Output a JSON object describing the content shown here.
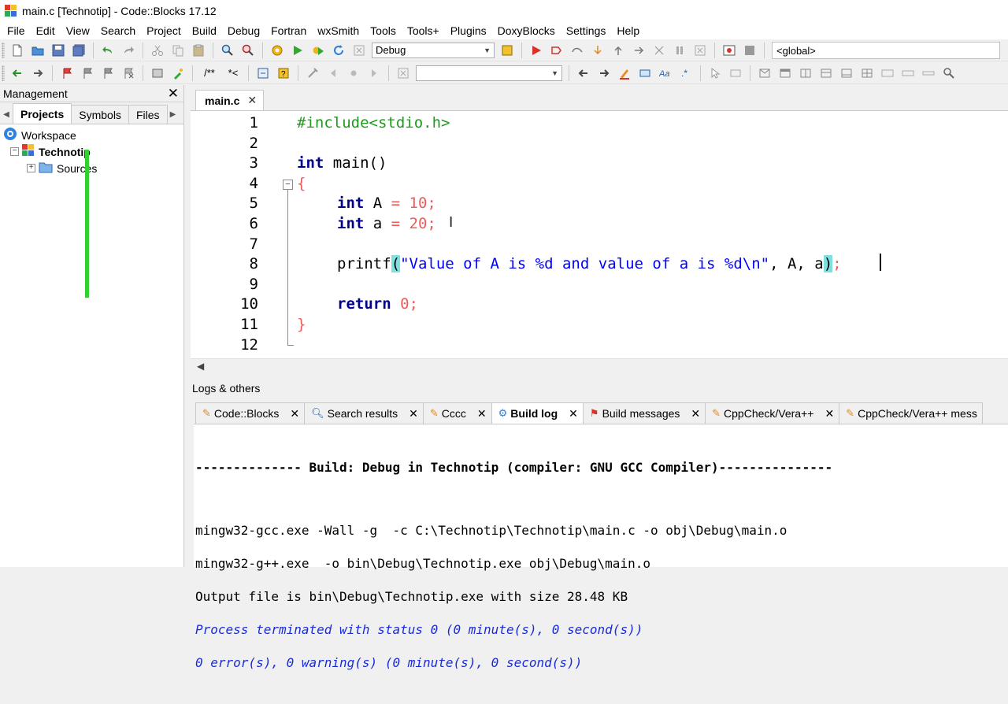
{
  "window": {
    "title": "main.c [Technotip] - Code::Blocks 17.12"
  },
  "menu": [
    "File",
    "Edit",
    "View",
    "Search",
    "Project",
    "Build",
    "Debug",
    "Fortran",
    "wxSmith",
    "Tools",
    "Tools+",
    "Plugins",
    "DoxyBlocks",
    "Settings",
    "Help"
  ],
  "toolbar": {
    "build_target": "Debug",
    "scope_value": "<global>",
    "search_value": "",
    "comment_block_label": "/**",
    "comment_line_label": "*<"
  },
  "management": {
    "title": "Management",
    "tabs": [
      "Projects",
      "Symbols",
      "Files"
    ],
    "tree": {
      "workspace": "Workspace",
      "project": "Technotip",
      "folder": "Sources"
    }
  },
  "editor": {
    "tab_label": "main.c",
    "line_numbers": [
      "1",
      "2",
      "3",
      "4",
      "5",
      "6",
      "7",
      "8",
      "9",
      "10",
      "11",
      "12"
    ],
    "code": {
      "l1": "#include<stdio.h>",
      "l3_kw": "int",
      "l3_rest": " main()",
      "l4": "{",
      "l5_kw": "int",
      "l5_var": " A ",
      "l5_op": "=",
      "l5_num": " 10;",
      "l6_kw": "int",
      "l6_var": " a ",
      "l6_op": "=",
      "l6_num": " 20;",
      "l8_fn": "printf",
      "l8_open": "(",
      "l8_str": "\"Value of A is %d and value of a is %d\\n\"",
      "l8_args": ", A, a",
      "l8_close": ")",
      "l8_end": ";",
      "l10_kw": "return",
      "l10_num": " 0;",
      "l11": "}"
    }
  },
  "logs": {
    "title": "Logs & others",
    "tabs": [
      {
        "label": "Code::Blocks",
        "icon": "pencil-icon"
      },
      {
        "label": "Search results",
        "icon": "search-icon"
      },
      {
        "label": "Cccc",
        "icon": "pencil-icon"
      },
      {
        "label": "Build log",
        "icon": "gear-icon"
      },
      {
        "label": "Build messages",
        "icon": "flag-icon"
      },
      {
        "label": "CppCheck/Vera++",
        "icon": "pencil-icon"
      },
      {
        "label": "CppCheck/Vera++ mess",
        "icon": "pencil-icon"
      }
    ],
    "build_log": {
      "header": "-------------- Build: Debug in Technotip (compiler: GNU GCC Compiler)---------------",
      "lines": [
        "mingw32-gcc.exe -Wall -g  -c C:\\Technotip\\Technotip\\main.c -o obj\\Debug\\main.o",
        "mingw32-g++.exe  -o bin\\Debug\\Technotip.exe obj\\Debug\\main.o",
        "Output file is bin\\Debug\\Technotip.exe with size 28.48 KB"
      ],
      "status": "Process terminated with status 0 (0 minute(s), 0 second(s))",
      "summary": "0 error(s), 0 warning(s) (0 minute(s), 0 second(s))"
    }
  }
}
